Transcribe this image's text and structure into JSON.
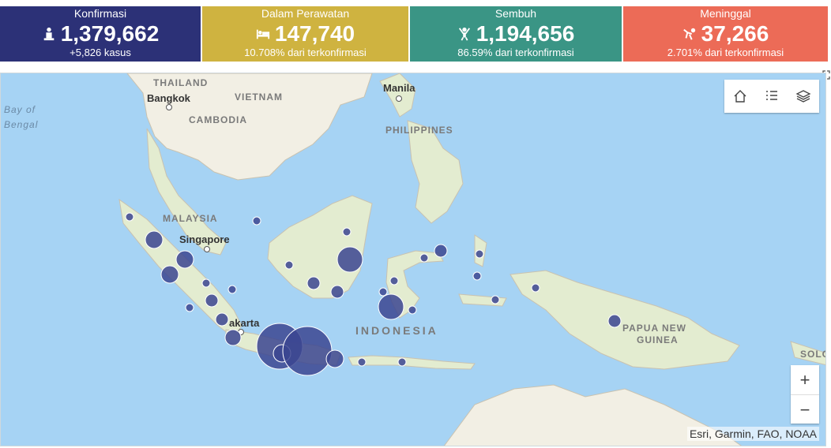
{
  "stats": {
    "confirmed": {
      "title": "Konfirmasi",
      "value": "1,379,662",
      "sub": "+5,826 kasus",
      "color": "#2c3177"
    },
    "treated": {
      "title": "Dalam Perawatan",
      "value": "147,740",
      "sub": "10.708% dari terkonfirmasi",
      "color": "#cfb340"
    },
    "recovered": {
      "title": "Sembuh",
      "value": "1,194,656",
      "sub": "86.59% dari terkonfirmasi",
      "color": "#3a9585"
    },
    "deaths": {
      "title": "Meninggal",
      "value": "37,266",
      "sub": "2.701% dari terkonfirmasi",
      "color": "#ec6b57"
    }
  },
  "map": {
    "labels": {
      "thailand": "THAILAND",
      "bangkok": "Bangkok",
      "vietnam": "VIETNAM",
      "cambodia": "CAMBODIA",
      "manila": "Manila",
      "philippines": "PHILIPPINES",
      "bay1": "Bay of",
      "bay2": "Bengal",
      "malaysia": "MALAYSIA",
      "singapore": "Singapore",
      "jakarta": "akarta",
      "indonesia": "INDONESIA",
      "png1": "PAPUA NEW",
      "png2": "GUINEA",
      "solo": "SOLO"
    },
    "attribution": "Esri, Garmin, FAO, NOAA",
    "zoom_in": "+",
    "zoom_out": "−"
  }
}
